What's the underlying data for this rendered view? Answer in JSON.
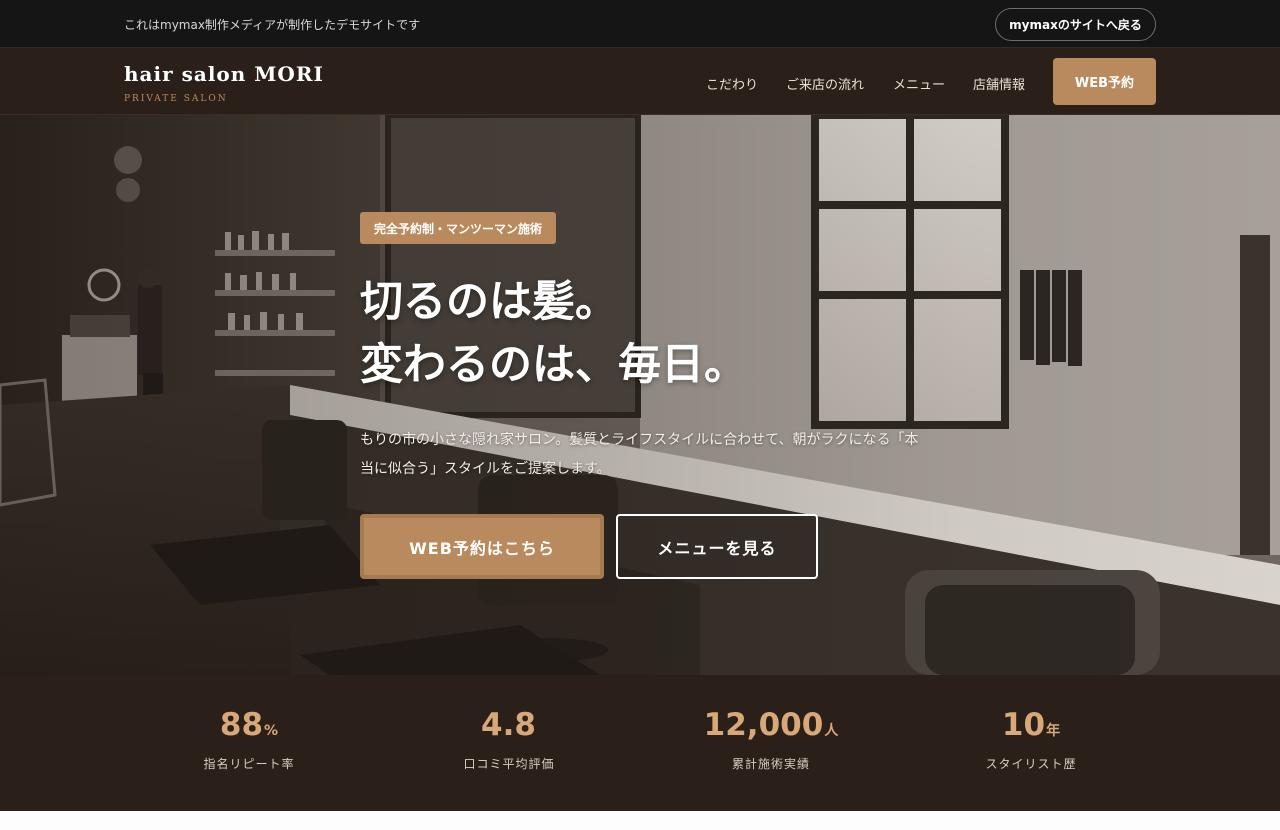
{
  "topbar": {
    "notice": "これはmymax制作メディアが制作したデモサイトです",
    "back_label": "mymaxのサイトへ戻る"
  },
  "header": {
    "logo": "hair salon MORI",
    "logo_sub": "PRIVATE SALON",
    "nav": [
      "こだわり",
      "ご来店の流れ",
      "メニュー",
      "店舗情報"
    ],
    "cta": "WEB予約"
  },
  "hero": {
    "badge": "完全予約制・マンツーマン施術",
    "headline_line1": "切るのは髪。",
    "headline_line2": "変わるのは、毎日。",
    "lead": "もりの市の小さな隠れ家サロン。髪質とライフスタイルに合わせて、朝がラクになる「本当に似合う」スタイルをご提案します。",
    "primary_button": "WEB予約はこちら",
    "secondary_button": "メニューを見る"
  },
  "stats": [
    {
      "value": "88",
      "unit": "%",
      "label": "指名リピート率"
    },
    {
      "value": "4.8",
      "unit": "",
      "label": "口コミ平均評価"
    },
    {
      "value": "12,000",
      "unit": "人",
      "label": "累計施術実績"
    },
    {
      "value": "10",
      "unit": "年",
      "label": "スタイリスト歴"
    }
  ],
  "colors": {
    "accent": "#b88a5d",
    "header_bg": "#2b2019",
    "topbar_bg": "#151515",
    "stat_value": "#d7a878"
  }
}
